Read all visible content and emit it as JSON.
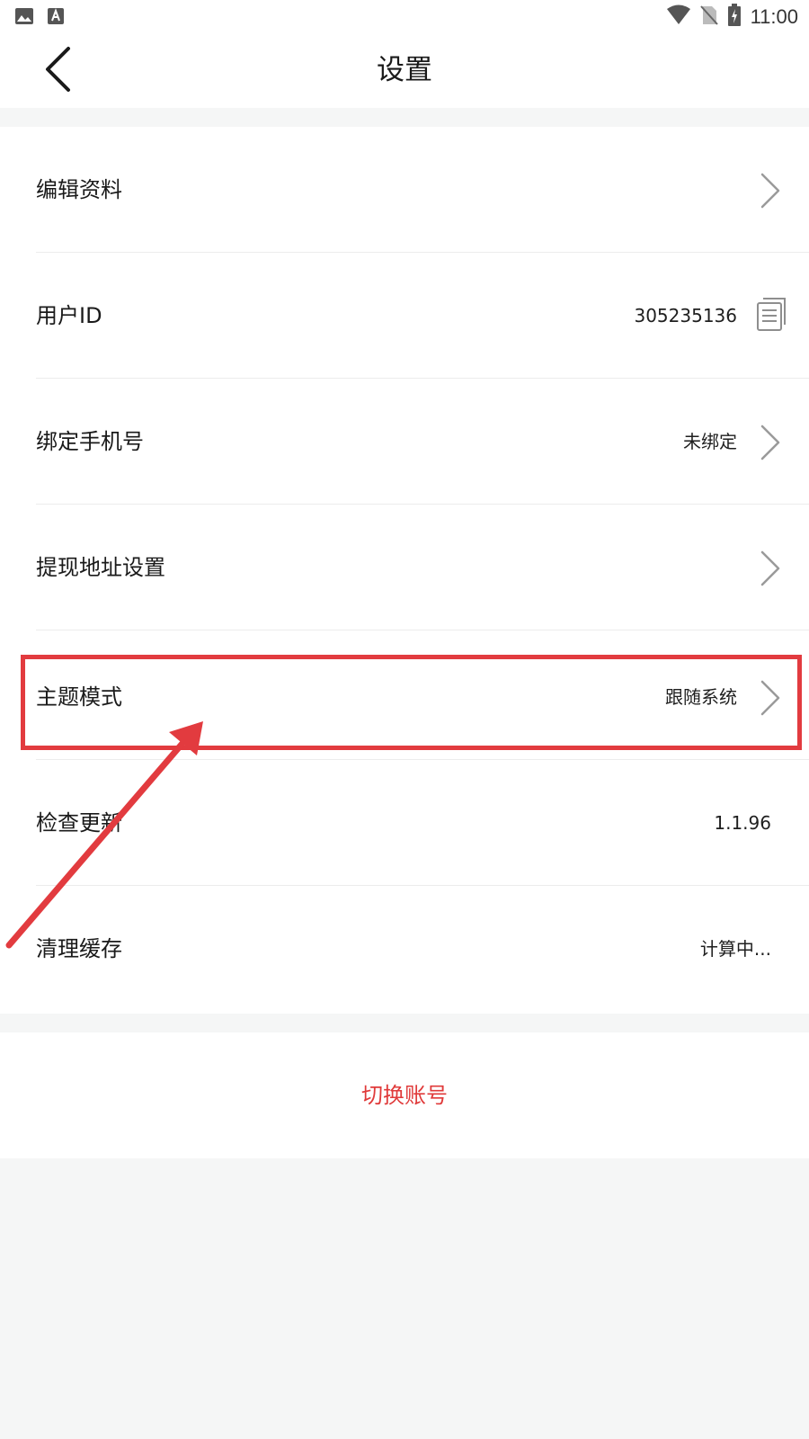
{
  "status_bar": {
    "time": "11:00",
    "left_icons": [
      "image-icon",
      "a-font-icon"
    ],
    "right_icons": [
      "wifi-icon",
      "no-sim-icon",
      "battery-charging-icon"
    ]
  },
  "header": {
    "title": "设置",
    "back_icon": "chevron-left-icon"
  },
  "settings": {
    "items": [
      {
        "label": "编辑资料",
        "value": "",
        "icon": "chevron-right-icon"
      },
      {
        "label": "用户ID",
        "value": "305235136",
        "icon": "copy-icon"
      },
      {
        "label": "绑定手机号",
        "value": "未绑定",
        "icon": "chevron-right-icon"
      },
      {
        "label": "提现地址设置",
        "value": "",
        "icon": "chevron-right-icon"
      },
      {
        "label": "主题模式",
        "value": "跟随系统",
        "icon": "chevron-right-icon"
      },
      {
        "label": "检查更新",
        "value": "1.1.96",
        "icon": ""
      },
      {
        "label": "清理缓存",
        "value": "计算中...",
        "icon": ""
      }
    ]
  },
  "actions": {
    "switch_account": "切换账号"
  },
  "colors": {
    "background": "#f5f6f6",
    "card": "#ffffff",
    "accent_red": "#e03a3a",
    "annotation_red": "#e23b3f",
    "chevron": "#9a9a9a"
  },
  "annotation": {
    "highlighted_item": "主题模式",
    "arrow_icon": "annotation-arrow-icon"
  }
}
